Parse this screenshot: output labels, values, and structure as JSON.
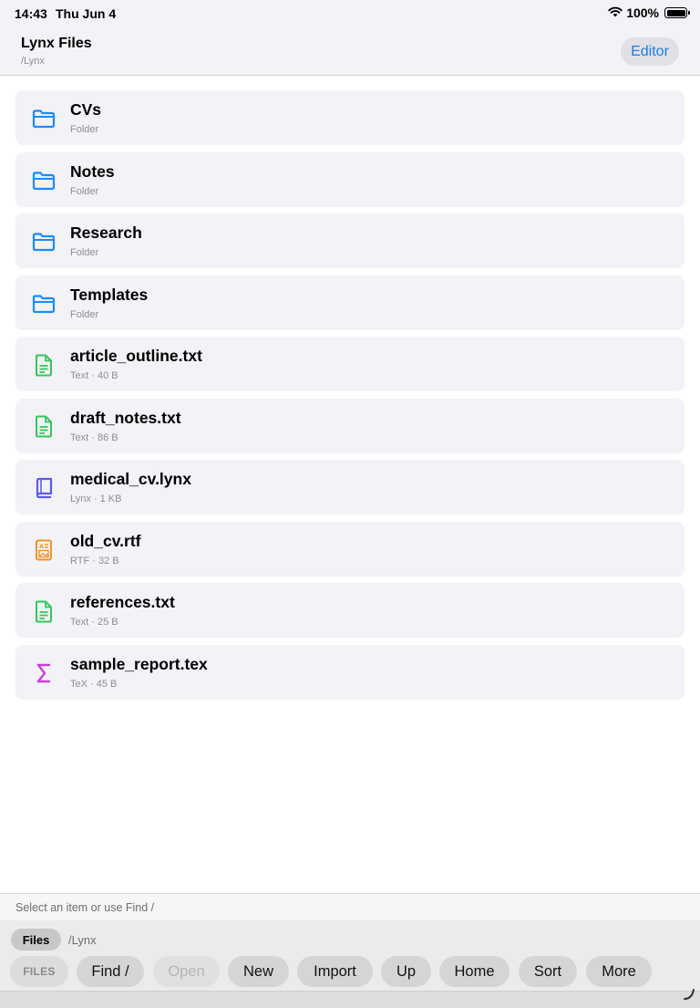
{
  "status_bar": {
    "time": "14:43",
    "date": "Thu Jun 4",
    "battery": "100%",
    "battery_level": 1.0
  },
  "header": {
    "title": "Lynx Files",
    "path": "/Lynx",
    "editor_label": "Editor"
  },
  "files": [
    {
      "name": "CVs",
      "meta": "Folder",
      "icon": "folder-icon",
      "color": "#1a8cff"
    },
    {
      "name": "Notes",
      "meta": "Folder",
      "icon": "folder-icon",
      "color": "#1a8cff"
    },
    {
      "name": "Research",
      "meta": "Folder",
      "icon": "folder-icon",
      "color": "#1a8cff"
    },
    {
      "name": "Templates",
      "meta": "Folder",
      "icon": "folder-icon",
      "color": "#1a8cff"
    },
    {
      "name": "article_outline.txt",
      "meta": "Text · 40 B",
      "icon": "text-file-icon",
      "color": "#34c759"
    },
    {
      "name": "draft_notes.txt",
      "meta": "Text · 86 B",
      "icon": "text-file-icon",
      "color": "#34c759"
    },
    {
      "name": "medical_cv.lynx",
      "meta": "Lynx · 1 KB",
      "icon": "book-icon",
      "color": "#5e5ce6"
    },
    {
      "name": "old_cv.rtf",
      "meta": "RTF · 32 B",
      "icon": "rtf-document-icon",
      "color": "#f0922b"
    },
    {
      "name": "references.txt",
      "meta": "Text · 25 B",
      "icon": "text-file-icon",
      "color": "#34c759"
    },
    {
      "name": "sample_report.tex",
      "meta": "TeX · 45 B",
      "icon": "sigma-icon",
      "color": "#c83fd8"
    }
  ],
  "hint": "Select an item or use Find /",
  "toolbar": {
    "files_label": "Files",
    "path": "/Lynx",
    "buttons": [
      {
        "label": "FILES",
        "kind": "mode"
      },
      {
        "label": "Find /",
        "kind": "normal"
      },
      {
        "label": "Open",
        "kind": "disabled"
      },
      {
        "label": "New",
        "kind": "normal"
      },
      {
        "label": "Import",
        "kind": "normal"
      },
      {
        "label": "Up",
        "kind": "normal"
      },
      {
        "label": "Home",
        "kind": "normal"
      },
      {
        "label": "Sort",
        "kind": "normal"
      },
      {
        "label": "More",
        "kind": "normal"
      }
    ]
  }
}
